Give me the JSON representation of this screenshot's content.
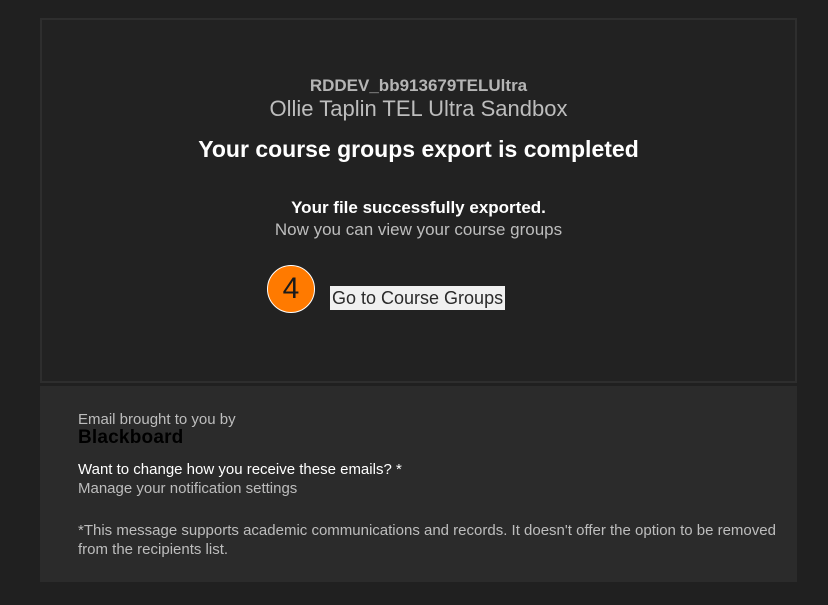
{
  "header": {
    "course_code": "RDDEV_bb913679TELUltra",
    "course_name": "Ollie Taplin TEL Ultra Sandbox"
  },
  "main": {
    "headline": "Your course groups export is completed",
    "success_message": "Your file successfully exported.",
    "sub_message": "Now you can view your course groups",
    "step_number": "4",
    "cta_label": "Go to Course Groups"
  },
  "footer": {
    "brought_by": "Email brought to you by",
    "brand": "Blackboard",
    "change_question": "Want to change how you receive these emails? *",
    "manage_link": "Manage your notification settings",
    "disclaimer": "*This message supports academic communications and records. It doesn't offer the option to be removed from the recipients list."
  },
  "colors": {
    "background": "#202020",
    "card": "#222222",
    "footer": "#2b2b2b",
    "accent": "#ff7a00"
  }
}
